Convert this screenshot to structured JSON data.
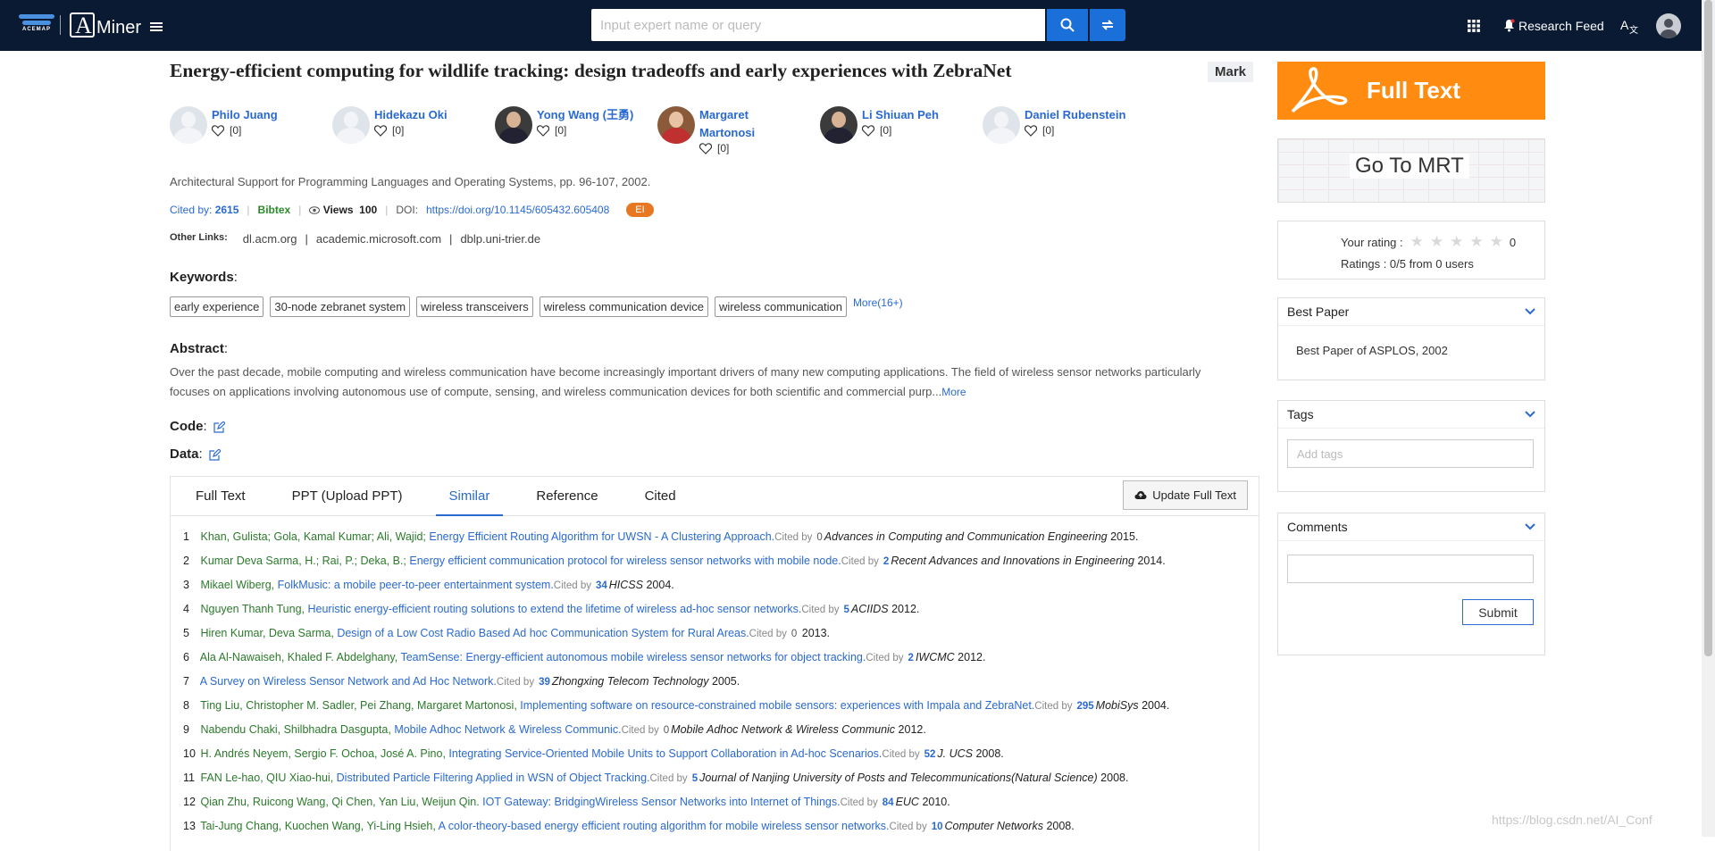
{
  "header": {
    "logo_left": "ACEMAP",
    "logo_right_initial": "A",
    "logo_right_text": "Miner",
    "search_placeholder": "Input expert name or query",
    "research_feed_label": "Research Feed"
  },
  "paper": {
    "title": "Energy-efficient computing for wildlife tracking: design tradeoffs and early experiences with ZebraNet",
    "mark_label": "Mark",
    "authors": [
      {
        "name": "Philo Juang",
        "likes": "[0]"
      },
      {
        "name": "Hidekazu Oki",
        "likes": "[0]"
      },
      {
        "name": "Yong Wang (王勇)",
        "likes": "[0]"
      },
      {
        "name": "Margaret Martonosi",
        "likes": "[0]"
      },
      {
        "name": "Li Shiuan Peh",
        "likes": "[0]"
      },
      {
        "name": "Daniel Rubenstein",
        "likes": "[0]"
      }
    ],
    "venue": "Architectural Support for Programming Languages and Operating Systems, pp. 96-107, 2002.",
    "cited_by_label": "Cited by:",
    "cited_by_count": "2615",
    "bibtex_label": "Bibtex",
    "views_label": "Views",
    "views_count": "100",
    "doi_label": "DOI:",
    "doi_value": "https://doi.org/10.1145/605432.605408",
    "ei_badge": "EI",
    "other_links_label": "Other Links:",
    "other_links": [
      "dl.acm.org",
      "academic.microsoft.com",
      "dblp.uni-trier.de"
    ],
    "keywords_label": "Keywords",
    "keywords": [
      "early experience",
      "30-node zebranet system",
      "wireless transceivers",
      "wireless communication device",
      "wireless communication"
    ],
    "keywords_more": "More(16+)",
    "abstract_label": "Abstract",
    "abstract_text": "Over the past decade, mobile computing and wireless communication have become increasingly important drivers of many new computing applications. The field of wireless sensor networks particularly focuses on applications involving autonomous use of compute, sensing, and wireless communication devices for both scientific and commercial purp...",
    "abstract_more": "More",
    "code_label": "Code",
    "data_label": "Data"
  },
  "tabs": {
    "items": [
      "Full Text",
      "PPT (Upload PPT)",
      "Similar",
      "Reference",
      "Cited"
    ],
    "active": "Similar",
    "update_label": "Update Full Text"
  },
  "similar": [
    {
      "n": "1",
      "authors": "Khan, Gulista; Gola, Kamal Kumar; Ali, Wajid;",
      "title": "Energy Efficient Routing Algorithm for UWSN - A Clustering Approach.",
      "cited": "0",
      "venue": "Advances in Computing and Communication Engineering",
      "year": "2015."
    },
    {
      "n": "2",
      "authors": "Kumar Deva Sarma, H.; Rai, P.; Deka, B.;",
      "title": "Energy efficient communication protocol for wireless sensor networks with mobile node.",
      "cited": "2",
      "venue": "Recent Advances and Innovations in Engineering",
      "year": "2014."
    },
    {
      "n": "3",
      "authors": "Mikael Wiberg,",
      "title": "FolkMusic: a mobile peer-to-peer entertainment system.",
      "cited": "34",
      "venue": "HICSS",
      "year": "2004."
    },
    {
      "n": "4",
      "authors": "Nguyen Thanh Tung,",
      "title": "Heuristic energy-efficient routing solutions to extend the lifetime of wireless ad-hoc sensor networks.",
      "cited": "5",
      "venue": "ACIIDS",
      "year": "2012."
    },
    {
      "n": "5",
      "authors": "Hiren Kumar, Deva Sarma,",
      "title": "Design of a Low Cost Radio Based Ad hoc Communication System for Rural Areas.",
      "cited": "0",
      "venue": "",
      "year": "2013."
    },
    {
      "n": "6",
      "authors": "Ala Al-Nawaiseh, Khaled F. Abdelghany,",
      "title": "TeamSense: Energy-efficient autonomous mobile wireless sensor networks for object tracking.",
      "cited": "2",
      "venue": "IWCMC",
      "year": "2012."
    },
    {
      "n": "7",
      "authors": "",
      "title": "A Survey on Wireless Sensor Network and Ad Hoc Network.",
      "cited": "39",
      "venue": "Zhongxing Telecom Technology",
      "year": "2005."
    },
    {
      "n": "8",
      "authors": "Ting Liu, Christopher M. Sadler, Pei Zhang, Margaret Martonosi,",
      "title": "Implementing software on resource-constrained mobile sensors: experiences with Impala and ZebraNet.",
      "cited": "295",
      "venue": "MobiSys",
      "year": "2004."
    },
    {
      "n": "9",
      "authors": "Nabendu Chaki, Shilbhadra Dasgupta,",
      "title": "Mobile Adhoc Network & Wireless Communic.",
      "cited": "0",
      "venue": "Mobile Adhoc Network & Wireless Communic",
      "year": "2012."
    },
    {
      "n": "10",
      "authors": "H. Andrés Neyem, Sergio F. Ochoa, José A. Pino,",
      "title": "Integrating Service-Oriented Mobile Units to Support Collaboration in Ad-hoc Scenarios.",
      "cited": "52",
      "venue": "J. UCS",
      "year": "2008."
    },
    {
      "n": "11",
      "authors": "FAN Le-hao, QIU Xiao-hui,",
      "title": "Distributed Particle Filtering Applied in WSN of Object Tracking.",
      "cited": "5",
      "venue": "Journal of Nanjing University of Posts and Telecommunications(Natural Science)",
      "year": "2008."
    },
    {
      "n": "12",
      "authors": "Qian Zhu, Ruicong Wang, Qi Chen, Yan Liu, Weijun Qin.",
      "title": "IOT Gateway: BridgingWireless Sensor Networks into Internet of Things.",
      "cited": "84",
      "venue": "EUC",
      "year": "2010."
    },
    {
      "n": "13",
      "authors": "Tai-Jung Chang, Kuochen Wang, Yi-Ling Hsieh,",
      "title": "A color-theory-based energy efficient routing algorithm for mobile wireless sensor networks.",
      "cited": "10",
      "venue": "Computer Networks",
      "year": "2008."
    }
  ],
  "cited_by_word": "Cited by",
  "sidebar": {
    "full_text_label": "Full Text",
    "mrt_label": "Go To MRT",
    "your_rating_label": "Your rating :",
    "your_rating_value": "0",
    "ratings_summary": "Ratings : 0/5 from 0 users",
    "best_paper_title": "Best Paper",
    "best_paper_body": "Best Paper of ASPLOS, 2002",
    "tags_title": "Tags",
    "tags_placeholder": "Add tags",
    "comments_title": "Comments",
    "submit_label": "Submit"
  },
  "watermark": "https://blog.csdn.net/AI_Conf",
  "colors": {
    "topbar": "#0a1a33",
    "accent": "#1a6fd8",
    "full_text": "#ff8c10",
    "link": "#2a6ad0",
    "author_green": "#2b7a2b"
  }
}
